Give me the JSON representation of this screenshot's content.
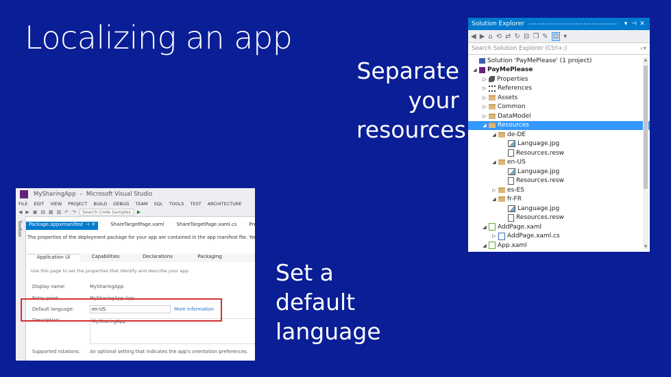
{
  "slide": {
    "title": "Localizing an app",
    "callout_resources": [
      "Separate",
      "your",
      "resources"
    ],
    "callout_language": [
      "Set a",
      "default",
      "language"
    ]
  },
  "solution_explorer": {
    "title": "Solution Explorer",
    "search_placeholder": "Search Solution Explorer (Ctrl+;)",
    "items": [
      {
        "label": "Solution 'PayMePlease' (1 project)",
        "icon": "solution-icon",
        "arrow": "",
        "indent": 0,
        "bold": false,
        "selected": false
      },
      {
        "label": "PayMePlease",
        "icon": "project-icon",
        "arrow": "◢",
        "indent": 0,
        "bold": true,
        "selected": false
      },
      {
        "label": "Properties",
        "icon": "wrench-icon",
        "arrow": "▷",
        "indent": 1,
        "bold": false,
        "selected": false
      },
      {
        "label": "References",
        "icon": "references-icon",
        "arrow": "▷",
        "indent": 1,
        "bold": false,
        "selected": false
      },
      {
        "label": "Assets",
        "icon": "folder-icon",
        "arrow": "▷",
        "indent": 1,
        "bold": false,
        "selected": false
      },
      {
        "label": "Common",
        "icon": "folder-icon",
        "arrow": "▷",
        "indent": 1,
        "bold": false,
        "selected": false
      },
      {
        "label": "DataModel",
        "icon": "folder-icon",
        "arrow": "▷",
        "indent": 1,
        "bold": false,
        "selected": false
      },
      {
        "label": "Resources",
        "icon": "folder-icon",
        "arrow": "◢",
        "indent": 1,
        "bold": false,
        "selected": true
      },
      {
        "label": "de-DE",
        "icon": "folder-icon",
        "arrow": "◢",
        "indent": 2,
        "bold": false,
        "selected": false
      },
      {
        "label": "Language.jpg",
        "icon": "image-icon",
        "arrow": "",
        "indent": 3,
        "bold": false,
        "selected": false
      },
      {
        "label": "Resources.resw",
        "icon": "file-icon",
        "arrow": "",
        "indent": 3,
        "bold": false,
        "selected": false
      },
      {
        "label": "en-US",
        "icon": "folder-icon",
        "arrow": "◢",
        "indent": 2,
        "bold": false,
        "selected": false
      },
      {
        "label": "Language.jpg",
        "icon": "image-icon",
        "arrow": "",
        "indent": 3,
        "bold": false,
        "selected": false
      },
      {
        "label": "Resources.resw",
        "icon": "file-icon",
        "arrow": "",
        "indent": 3,
        "bold": false,
        "selected": false
      },
      {
        "label": "es-ES",
        "icon": "folder-icon",
        "arrow": "▷",
        "indent": 2,
        "bold": false,
        "selected": false
      },
      {
        "label": "fr-FR",
        "icon": "folder-icon",
        "arrow": "◢",
        "indent": 2,
        "bold": false,
        "selected": false
      },
      {
        "label": "Language.jpg",
        "icon": "image-icon",
        "arrow": "",
        "indent": 3,
        "bold": false,
        "selected": false
      },
      {
        "label": "Resources.resw",
        "icon": "file-icon",
        "arrow": "",
        "indent": 3,
        "bold": false,
        "selected": false
      },
      {
        "label": "AddPage.xaml",
        "icon": "xaml-icon",
        "arrow": "◢",
        "indent": 1,
        "bold": false,
        "selected": false
      },
      {
        "label": "AddPage.xaml.cs",
        "icon": "csharp-icon",
        "arrow": "▷",
        "indent": 2,
        "bold": false,
        "selected": false
      },
      {
        "label": "App.xaml",
        "icon": "xaml-icon",
        "arrow": "◢",
        "indent": 1,
        "bold": false,
        "selected": false
      }
    ]
  },
  "visual_studio": {
    "app_name": "MySharingApp",
    "product": "Microsoft Visual Studio",
    "menu": [
      "FILE",
      "EDIT",
      "VIEW",
      "PROJECT",
      "BUILD",
      "DEBUG",
      "TEAM",
      "SQL",
      "TOOLS",
      "TEST",
      "ARCHITECTURE"
    ],
    "toolbar_search": "Search Code Samples",
    "side_panel": "Toolbox",
    "tabs": [
      "Package.appxmanifest",
      "ShareTargetPage.xaml",
      "ShareTargetPage.xaml.cs",
      "Preferenc"
    ],
    "info_text": "The properties of the deployment package for your app are contained in the app manifest file. You can use",
    "subtabs": [
      "Application UI",
      "Capabilities",
      "Declarations",
      "Packaging"
    ],
    "description_text": "Use this page to set the properties that identify and describe your app.",
    "fields": {
      "display_name_label": "Display name:",
      "display_name_value": "MySharingApp",
      "entry_point_label": "Entry point:",
      "entry_point_value": "MySharingApp.App",
      "default_language_label": "Default language:",
      "default_language_value": "en-US",
      "more_info_link": "More information",
      "description_label": "Description:",
      "description_value": "MySharingApp",
      "supported_rotations_label": "Supported rotations:",
      "supported_rotations_text": "An optional setting that indicates the app's orientation preferences."
    }
  },
  "colors": {
    "slide_background": "#0a1e96",
    "vs_accent": "#007acc",
    "selection": "#3399ff",
    "highlight_border": "#d32f2f"
  }
}
